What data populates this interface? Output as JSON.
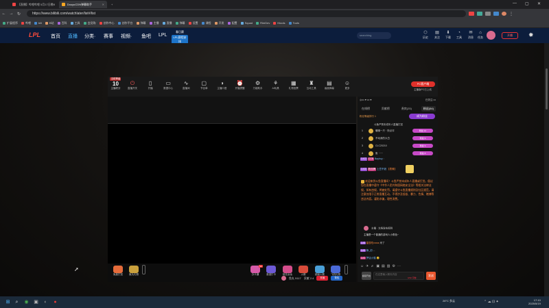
{
  "browser": {
    "tabs": [
      {
        "label": "【直播】哔哩哔哩 5月17日晚8点…",
        "active": false
      },
      {
        "label": "DouyuCDN弹幕助手",
        "active": true
      }
    ],
    "url": "https://www.bilibili.com/watchlater/list#/list",
    "bookmarks": [
      "扩展程序",
      "哔哩",
      "bili",
      "B站",
      "百科",
      "工具",
      "会员购",
      "创作中心",
      "创作平台",
      "弹幕",
      "主播",
      "直播",
      "弹幕",
      "设置",
      "课程",
      "开发",
      "配置",
      "Squad",
      "RimDev",
      "Ktools",
      "Tools"
    ]
  },
  "site": {
    "logo": "LPL",
    "nav": [
      {
        "label": "首页",
        "active": false
      },
      {
        "label": "直播",
        "active": true
      },
      {
        "label": "分类·",
        "active": false
      },
      {
        "label": "赛事",
        "active": false
      },
      {
        "label": "视频·",
        "active": false
      },
      {
        "label": "鱼吧",
        "active": false
      },
      {
        "label": "LPL",
        "active": false
      }
    ],
    "schedule": {
      "line1": "春日赛",
      "line2": "LPL赛程安排"
    },
    "search_placeholder": "searching",
    "header_icons": [
      {
        "glyph": "⬡",
        "label": "历史"
      },
      {
        "glyph": "▤",
        "label": "关注"
      },
      {
        "glyph": "⬇",
        "label": "下载"
      },
      {
        "glyph": "◔",
        "label": "工具"
      },
      {
        "glyph": "✉",
        "label": "消息"
      },
      {
        "glyph": "⌂",
        "label": "任务"
      }
    ],
    "start_live": "开播"
  },
  "studio": {
    "level_badge": "当前等级",
    "level_value": "10",
    "level_sub": "主播积分",
    "tools": [
      {
        "glyph": "⏻",
        "label": "直播开关"
      },
      {
        "glyph": "▯",
        "label": "开播"
      },
      {
        "glyph": "▭",
        "label": "数据中心"
      },
      {
        "glyph": "∿",
        "label": "直播间"
      },
      {
        "glyph": "▢",
        "label": "节目单"
      },
      {
        "glyph": "◑",
        "label": "主播口语"
      },
      {
        "glyph": "⏰",
        "label": "开播提醒"
      },
      {
        "glyph": "⚙",
        "label": "万能助手"
      },
      {
        "glyph": "⚘",
        "label": "AI玩具"
      },
      {
        "glyph": "▦",
        "label": "礼物投票"
      },
      {
        "glyph": "♜",
        "label": "互动工具"
      },
      {
        "glyph": "▤",
        "label": "画面弹幕"
      },
      {
        "glyph": "☺",
        "label": "更多"
      }
    ],
    "pc_button": "PC客户端",
    "pc_sub": "主播版PC已上线",
    "gifts": [
      {
        "label": "免费打赏",
        "tag": "",
        "color": "#e56b3a"
      },
      {
        "label": "鱼丸礼物",
        "tag": "",
        "color": "#c9a03c"
      },
      {
        "label": "办卡通",
        "tag": "hot",
        "color": "#d65aa8"
      },
      {
        "label": "浪漫打卡",
        "tag": "",
        "color": "#6d5ad6"
      },
      {
        "label": "桃花朵朵",
        "tag": "",
        "color": "#d44d8b"
      },
      {
        "label": "火箭",
        "tag": "",
        "color": "#d84b3a"
      },
      {
        "label": "超级火箭",
        "tag": "",
        "color": "#4aa0d8"
      },
      {
        "label": "飞机礼物",
        "tag": "",
        "color": "#4b6ad8"
      }
    ],
    "status": {
      "fans": "鱼丸 5117",
      "contribution": "贡献 2.4",
      "red_btn": "充值",
      "blue_btn": "背包"
    }
  },
  "chat": {
    "header_left": "◎••• ♥ ••• ♥",
    "header_right": "已关注 •••",
    "tabs": [
      {
        "label": "在线榜",
        "active": false
      },
      {
        "label": "贡献榜",
        "active": false
      },
      {
        "label": "贵宾(25)",
        "active": false
      },
      {
        "label": "粉丝(54)",
        "active": true
      }
    ],
    "rank_header": "粉丝等级排行 1",
    "rank_button": "成为粉丝",
    "rank_sub": "斗鱼严禁未成年人直播打赏",
    "ranks": [
      {
        "no": "1",
        "name": "暖暖一只 · 快点评",
        "pill": "粉丝 12"
      },
      {
        "no": "2",
        "name": "不动我的大白",
        "pill": "粉丝 9"
      },
      {
        "no": "3",
        "name": "CLC20210",
        "pill": "粉丝 9"
      },
      {
        "no": "4",
        "name": "鱼 ······",
        "pill": "粉丝 8"
      }
    ],
    "messages": [
      {
        "lvl": "Lv12",
        "medal": "CCB",
        "user": "Bayboy",
        "text": ":"
      },
      {
        "lvl": "Lv16",
        "medal": "粉丝牌",
        "user": "土豆不浪",
        "text": "【表情】"
      }
    ],
    "notice": "欢迎来到斗鱼直播间！斗鱼严禁未成年人直播或打赏。倡议您在直播中遵守《中华人民共和国网络安全法》等相关法律法规，如有违规，将被处罚，请遵守斗鱼直播规则及社区规范，请注意仅限于正常直播互动，不得涉及低俗、暴力、色情、赌博等违法内容。谨防诈骗，理性消费。",
    "anchor_row": "主播  · 文档发布规则",
    "anchor_msg": "主播是一个普通的游戏人小角色~",
    "m1": {
      "lvl": "Lv8",
      "user": "星辰吃cross",
      "text": "来了"
    },
    "m2": {
      "lvl": "Lv5",
      "user": "静_初",
      "text": "..."
    },
    "m3": {
      "lvl": "Lv3",
      "user": "梦话小猫",
      "text": "😊"
    },
    "tools": [
      "☺",
      "✈",
      "♬",
      "▣",
      "▤",
      "▥",
      "⚙",
      "⋯"
    ],
    "input_placeholder": "在这里输入聊天内容",
    "avatar_label": "超级开启",
    "count_label": "0/30 字数",
    "send_label": "发送"
  },
  "taskbar": {
    "items": [
      "⊞",
      "⌕",
      "◉",
      "▣",
      "◐",
      "●"
    ],
    "weather": "28°C 多云",
    "time": "17:10",
    "date": "2025/5/19"
  },
  "colors": {
    "accent_red": "#e0312b",
    "accent_blue": "#4fb8ff",
    "header_bg": "#0c1d3c"
  }
}
